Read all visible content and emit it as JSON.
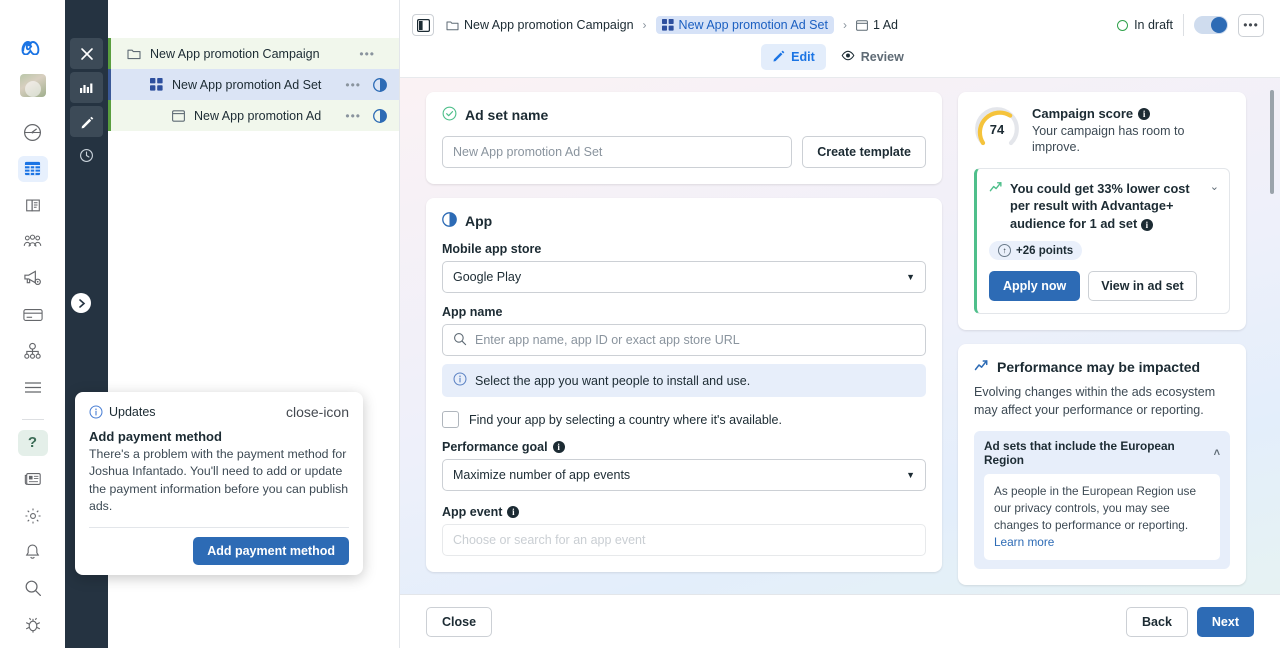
{
  "icon_rail": {
    "items": [
      {
        "name": "meta-logo-icon",
        "label": "Meta"
      },
      {
        "name": "account-avatar",
        "label": "Account avatar"
      },
      {
        "name": "dashboard-gauge-icon",
        "label": "Dashboard"
      },
      {
        "name": "table-grid-icon",
        "label": "Campaigns table"
      },
      {
        "name": "library-icon",
        "label": "Library"
      },
      {
        "name": "audiences-icon",
        "label": "Audiences"
      },
      {
        "name": "announcement-settings-icon",
        "label": "Ads settings"
      },
      {
        "name": "billing-card-icon",
        "label": "Billing"
      },
      {
        "name": "events-manager-icon",
        "label": "Events manager"
      },
      {
        "name": "hamburger-menu-icon",
        "label": "All tools"
      },
      {
        "name": "help-question-icon",
        "label": "Help"
      },
      {
        "name": "news-icon",
        "label": "News"
      },
      {
        "name": "settings-gear-icon",
        "label": "Settings"
      },
      {
        "name": "notifications-bell-icon",
        "label": "Notifications"
      },
      {
        "name": "search-icon",
        "label": "Search"
      },
      {
        "name": "bug-report-icon",
        "label": "Report a bug"
      }
    ]
  },
  "dark_rail": {
    "items": [
      {
        "name": "close-icon",
        "glyph": "✕",
        "selected": false
      },
      {
        "name": "chart-bars-icon",
        "glyph": "bars",
        "selected": true
      },
      {
        "name": "edit-pencil-icon",
        "glyph": "pencil",
        "selected": true
      },
      {
        "name": "history-clock-icon",
        "glyph": "clock",
        "selected": false
      }
    ],
    "expand_label": "❯"
  },
  "tree": {
    "rows": [
      {
        "label": "New App promotion Campaign",
        "level": 0,
        "icon": "folder-icon",
        "type": "campaign",
        "has_toggle": false,
        "dots": "•••"
      },
      {
        "label": "New App promotion Ad Set",
        "level": 1,
        "icon": "adset-grid-icon",
        "type": "adset",
        "has_toggle": true,
        "dots": "•••"
      },
      {
        "label": "New App promotion Ad",
        "level": 2,
        "icon": "ad-window-icon",
        "type": "ad",
        "has_toggle": true,
        "dots": "•••"
      }
    ]
  },
  "header": {
    "panel_toggle_name": "panel-layout-icon",
    "breadcrumb": [
      {
        "label": "New App promotion Campaign",
        "icon": "folder-icon",
        "selected": false
      },
      {
        "label": "New App promotion Ad Set",
        "icon": "adset-grid-icon",
        "selected": true
      },
      {
        "label": "1 Ad",
        "icon": "ad-window-icon",
        "selected": false
      }
    ],
    "separator": "›",
    "status": "In draft",
    "kebab": "•••",
    "tabs": [
      {
        "label": "Edit",
        "icon": "edit-pencil-icon",
        "active": true
      },
      {
        "label": "Review",
        "icon": "eye-icon",
        "active": false
      }
    ]
  },
  "adset_name_card": {
    "title": "Ad set name",
    "status_icon": "check-circle-icon",
    "input_value": "New App promotion Ad Set",
    "input_placeholder": "New App promotion Ad Set",
    "create_template_label": "Create template"
  },
  "app_card": {
    "title": "App",
    "icon": "app-contrast-icon",
    "mobile_app_store_label": "Mobile app store",
    "mobile_app_store_value": "Google Play",
    "app_name_label": "App name",
    "app_name_placeholder": "Enter app name, app ID or exact app store URL",
    "notice_text": "Select the app you want people to install and use.",
    "notice_icon": "info-circle-icon",
    "country_checkbox_label": "Find your app by selecting a country where it's available.",
    "country_checkbox_checked": false,
    "performance_goal_label": "Performance goal",
    "performance_goal_value": "Maximize number of app events",
    "app_event_label": "App event",
    "app_event_placeholder": "Choose or search for an app event"
  },
  "score_card": {
    "score": "74",
    "score_percent": 74,
    "title": "Campaign score",
    "subtitle": "Your campaign has room to improve.",
    "gauge_color": "#f5c33b",
    "gauge_track": "#e4e6eb",
    "suggestion": {
      "text": "You could get 33% lower cost per result with Advantage+ audience for 1 ad set",
      "icon": "trend-up-icon",
      "chevron": "⌄",
      "points_label": "+26 points",
      "points_icon": "arrow-up-circle-icon",
      "primary_button": "Apply now",
      "secondary_button": "View in ad set",
      "accent_color": "#4fbf8b"
    }
  },
  "performance_card": {
    "title": "Performance may be impacted",
    "icon": "trend-up-icon",
    "body": "Evolving changes within the ads ecosystem may affect your performance or reporting.",
    "accordion_title": "Ad sets that include the European Region",
    "accordion_chevron": "˄",
    "accordion_body": "As people in the European Region use our privacy controls, you may see changes to performance or reporting.",
    "accordion_link": "Learn more"
  },
  "updates_popover": {
    "header": "Updates",
    "header_icon": "info-circle-icon",
    "close_icon": "close-icon",
    "title": "Add payment method",
    "body": "There's a problem with the payment method for Joshua Infantado. You'll need to add or update the payment information before you can publish ads.",
    "button_label": "Add payment method"
  },
  "footer": {
    "close_label": "Close",
    "back_label": "Back",
    "next_label": "Next"
  },
  "colors": {
    "brand_blue": "#1b74e4",
    "primary_button": "#2d6bb5",
    "dark_rail": "#253341",
    "green_accent": "#4fbf8b",
    "draft_green": "#31a24c"
  }
}
